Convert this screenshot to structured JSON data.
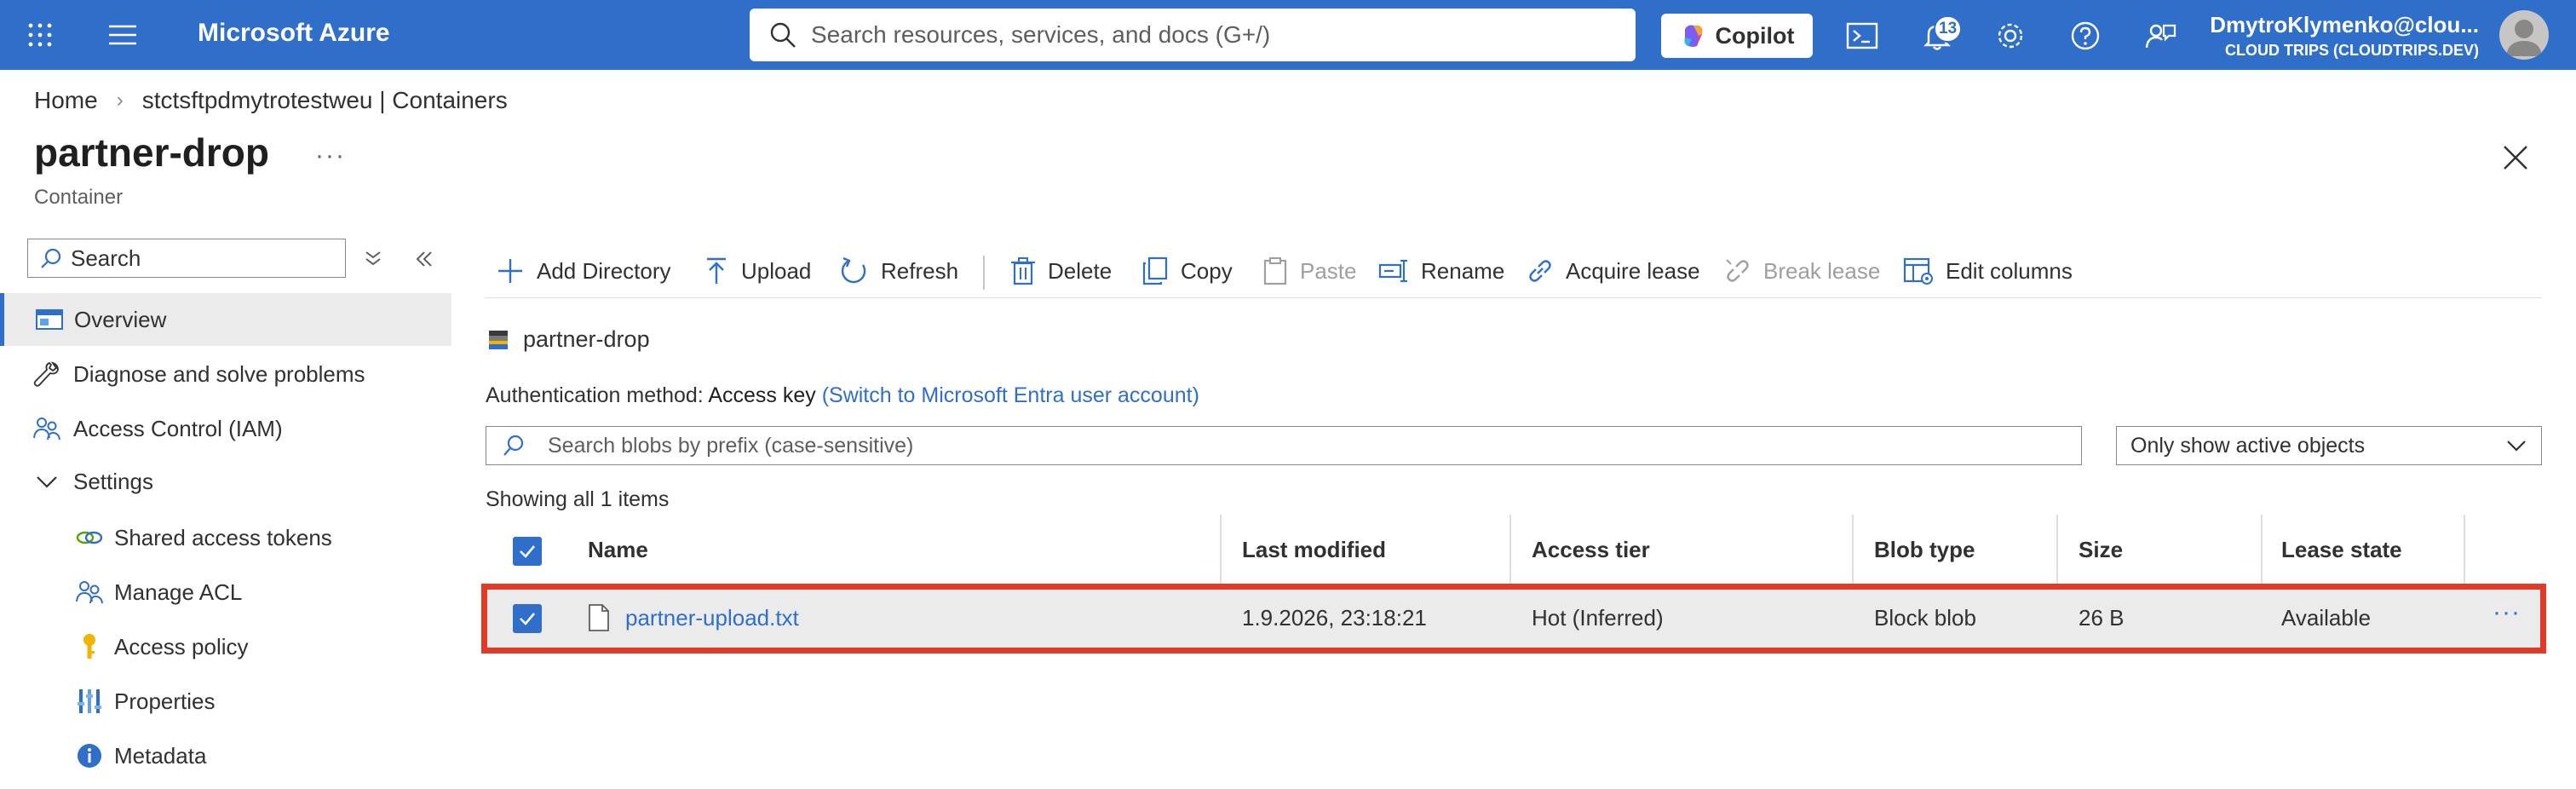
{
  "topbar": {
    "brand": "Microsoft Azure",
    "search_placeholder": "Search resources, services, and docs (G+/)",
    "copilot_label": "Copilot",
    "notification_count": "13",
    "account_user": "DmytroKlymenko@clou...",
    "account_tenant": "CLOUD TRIPS (CLOUDTRIPS.DEV)",
    "bar_color": "#2f6fc9"
  },
  "breadcrumb": {
    "home": "Home",
    "parent": "stctsftpdmytrotestweu | Containers"
  },
  "page": {
    "title": "partner-drop",
    "subtitle": "Container",
    "more": "···"
  },
  "nav": {
    "search_placeholder": "Search",
    "items": [
      {
        "label": "Overview",
        "icon": "overview-icon"
      },
      {
        "label": "Diagnose and solve problems",
        "icon": "wrench-icon"
      },
      {
        "label": "Access Control (IAM)",
        "icon": "people-icon"
      },
      {
        "label": "Settings",
        "icon": "chevron-down-icon"
      },
      {
        "label": "Shared access tokens",
        "icon": "link-icon"
      },
      {
        "label": "Manage ACL",
        "icon": "people-icon"
      },
      {
        "label": "Access policy",
        "icon": "key-icon"
      },
      {
        "label": "Properties",
        "icon": "properties-icon"
      },
      {
        "label": "Metadata",
        "icon": "info-icon"
      }
    ]
  },
  "toolbar": {
    "add_directory": "Add Directory",
    "upload": "Upload",
    "refresh": "Refresh",
    "delete": "Delete",
    "copy": "Copy",
    "paste": "Paste",
    "rename": "Rename",
    "acquire_lease": "Acquire lease",
    "break_lease": "Break lease",
    "edit_columns": "Edit columns"
  },
  "container": {
    "name": "partner-drop",
    "auth_label": "Authentication method:",
    "auth_value": "Access key",
    "auth_switch": "(Switch to Microsoft Entra user account)",
    "blob_search_placeholder": "Search blobs by prefix (case-sensitive)",
    "filter_value": "Only show active objects",
    "showing": "Showing all 1 items"
  },
  "table": {
    "columns": [
      "Name",
      "Last modified",
      "Access tier",
      "Blob type",
      "Size",
      "Lease state"
    ],
    "rows": [
      {
        "name": "partner-upload.txt",
        "last_modified": "1.9.2026, 23:18:21",
        "access_tier": "Hot (Inferred)",
        "blob_type": "Block blob",
        "size": "26 B",
        "lease_state": "Available",
        "more": "···",
        "selected": true
      }
    ]
  },
  "colors": {
    "accent": "#2f6fc9",
    "highlight": "#e33a28"
  }
}
